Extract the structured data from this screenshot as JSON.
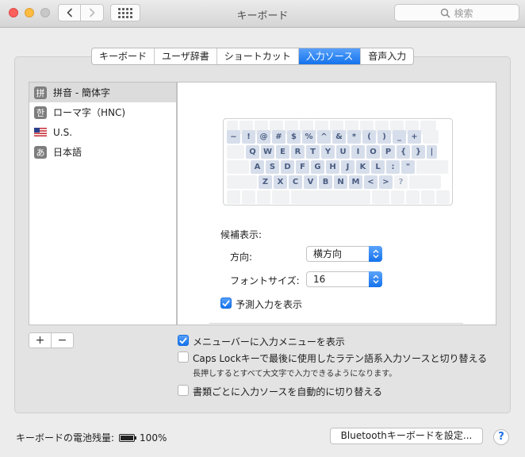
{
  "window": {
    "title": "キーボード"
  },
  "search": {
    "placeholder": "検索"
  },
  "tabs": [
    {
      "label": "キーボード",
      "active": false
    },
    {
      "label": "ユーザ辞書",
      "active": false
    },
    {
      "label": "ショートカット",
      "active": false
    },
    {
      "label": "入力ソース",
      "active": true
    },
    {
      "label": "音声入力",
      "active": false
    }
  ],
  "sources": [
    {
      "label": "拼音 - 簡体字",
      "icon": "拼",
      "selected": true
    },
    {
      "label": "ローマ字（HNC)",
      "icon": "한",
      "selected": false
    },
    {
      "label": "U.S.",
      "icon": "us-flag",
      "selected": false
    },
    {
      "label": "日本語",
      "icon": "あ",
      "selected": false
    }
  ],
  "keyboard": {
    "row1": [
      "~",
      "!",
      "@",
      "#",
      "$",
      "%",
      "^",
      "&",
      "*",
      "(",
      ")",
      "_",
      "+"
    ],
    "row2": [
      "Q",
      "W",
      "E",
      "R",
      "T",
      "Y",
      "U",
      "I",
      "O",
      "P",
      "{",
      "}",
      "|"
    ],
    "row3": [
      "A",
      "S",
      "D",
      "F",
      "G",
      "H",
      "J",
      "K",
      "L",
      ":",
      "\""
    ],
    "row4": [
      "Z",
      "X",
      "C",
      "V",
      "B",
      "N",
      "M",
      "<",
      ">",
      "?"
    ]
  },
  "detail": {
    "candidate_heading": "候補表示:",
    "orientation_label": "方向:",
    "orientation_value": "横方向",
    "font_size_label": "フォントサイズ:",
    "font_size_value": "16",
    "predictive_label": "予測入力を表示",
    "predictive_checked": true
  },
  "controls": {
    "add": "+",
    "remove": "−"
  },
  "options": {
    "menu_bar_label": "メニューバーに入力メニューを表示",
    "menu_bar_checked": true,
    "caps_lock_label": "Caps Lockキーで最後に使用したラテン語系入力ソースと切り替える",
    "caps_lock_checked": false,
    "caps_lock_note": "長押しするとすべて大文字で入力できるようになります。",
    "auto_switch_label": "書類ごとに入力ソースを自動的に切り替える",
    "auto_switch_checked": false
  },
  "footer": {
    "battery_label": "キーボードの電池残量:",
    "battery_level": "100%",
    "bluetooth_button": "Bluetoothキーボードを設定...",
    "help": "?"
  },
  "colors": {
    "accent": "#1473ec",
    "close": "#fc605c",
    "minimize": "#fdbc40"
  }
}
